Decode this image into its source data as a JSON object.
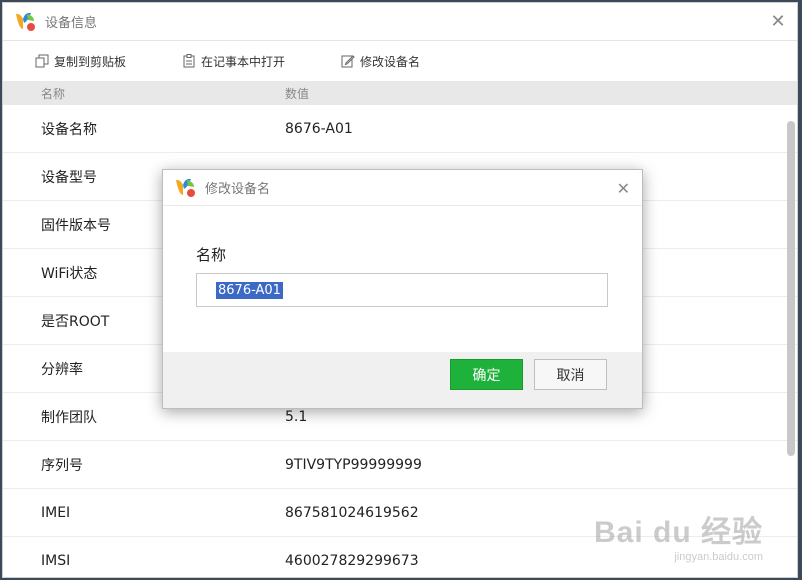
{
  "window": {
    "title": "设备信息",
    "close_symbol": "✕"
  },
  "toolbar": {
    "items": [
      {
        "label": "复制到剪贴板",
        "icon": "copy-icon"
      },
      {
        "label": "在记事本中打开",
        "icon": "notepad-icon"
      },
      {
        "label": "修改设备名",
        "icon": "edit-icon"
      }
    ]
  },
  "table": {
    "headers": {
      "name": "名称",
      "value": "数值"
    },
    "rows": [
      {
        "name": "设备名称",
        "value": "8676-A01"
      },
      {
        "name": "设备型号",
        "value": ""
      },
      {
        "name": "固件版本号",
        "value": ""
      },
      {
        "name": "WiFi状态",
        "value": ""
      },
      {
        "name": "是否ROOT",
        "value": ""
      },
      {
        "name": "分辨率",
        "value": ""
      },
      {
        "name": "制作团队",
        "value": "5.1"
      },
      {
        "name": "序列号",
        "value": "9TIV9TYP99999999"
      },
      {
        "name": "IMEI",
        "value": "867581024619562"
      },
      {
        "name": "IMSI",
        "value": "460027829299673"
      }
    ]
  },
  "dialog": {
    "title": "修改设备名",
    "close_symbol": "✕",
    "field_label": "名称",
    "input_value": "8676-A01",
    "ok_label": "确定",
    "cancel_label": "取消"
  },
  "watermark": {
    "line1": "Bai du 经验",
    "line2": "jingyan.baidu.com"
  },
  "colors": {
    "ok_button": "#1fb23a",
    "selection": "#3b69c5"
  }
}
